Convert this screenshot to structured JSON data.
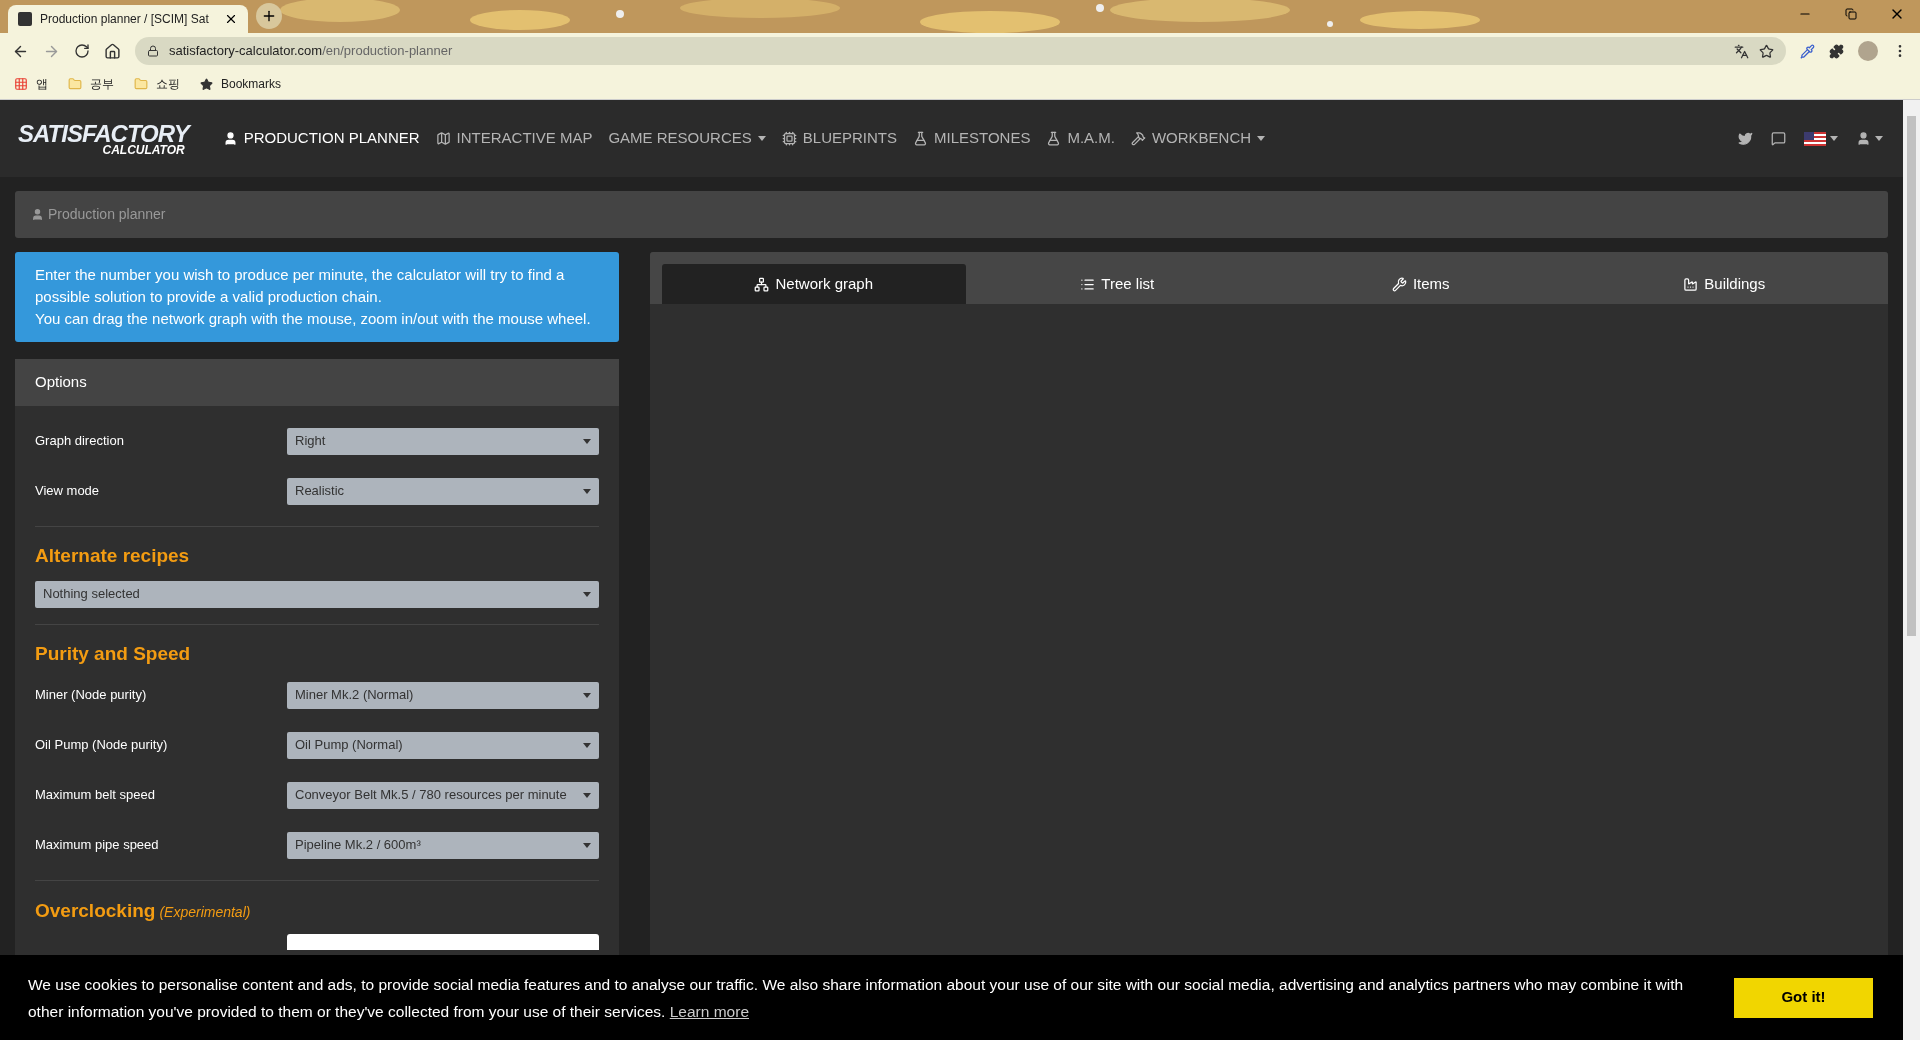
{
  "browser": {
    "tab_title": "Production planner / [SCIM] Sat",
    "url_domain": "satisfactory-calculator.com",
    "url_path": "/en/production-planner",
    "bookmarks": [
      {
        "label": "앱",
        "kind": "apps"
      },
      {
        "label": "공부",
        "kind": "folder"
      },
      {
        "label": "쇼핑",
        "kind": "folder"
      },
      {
        "label": "Bookmarks",
        "kind": "star"
      }
    ]
  },
  "logo": {
    "line1": "SATISFACTORY",
    "line2": "CALCULATOR"
  },
  "nav": [
    {
      "label": "PRODUCTION PLANNER",
      "kind": "user",
      "selected": true,
      "dropdown": false
    },
    {
      "label": "INTERACTIVE MAP",
      "kind": "map",
      "selected": false,
      "dropdown": false
    },
    {
      "label": "GAME RESOURCES",
      "kind": "none",
      "selected": false,
      "dropdown": true
    },
    {
      "label": "BLUEPRINTS",
      "kind": "chip",
      "selected": false,
      "dropdown": false
    },
    {
      "label": "MILESTONES",
      "kind": "flask",
      "selected": false,
      "dropdown": false
    },
    {
      "label": "M.A.M.",
      "kind": "flask",
      "selected": false,
      "dropdown": false
    },
    {
      "label": "WORKBENCH",
      "kind": "hammer",
      "selected": false,
      "dropdown": true
    }
  ],
  "breadcrumb": "Production planner",
  "info": [
    "Enter the number you wish to produce per minute, the calculator will try to find a possible solution to provide a valid production chain.",
    "You can drag the network graph with the mouse, zoom in/out with the mouse wheel."
  ],
  "options": {
    "title": "Options",
    "rows": [
      {
        "label": "Graph direction",
        "value": "Right"
      },
      {
        "label": "View mode",
        "value": "Realistic"
      }
    ],
    "alternate_recipes": {
      "heading": "Alternate recipes",
      "value": "Nothing selected"
    },
    "purity": {
      "heading": "Purity and Speed",
      "rows": [
        {
          "label": "Miner (Node purity)",
          "value": "Miner Mk.2 (Normal)"
        },
        {
          "label": "Oil Pump (Node purity)",
          "value": "Oil Pump (Normal)"
        },
        {
          "label": "Maximum belt speed",
          "value": "Conveyor Belt Mk.5 / 780 resources per minute"
        },
        {
          "label": "Maximum pipe speed",
          "value": "Pipeline Mk.2 / 600m³"
        }
      ]
    },
    "overclocking": {
      "heading": "Overclocking",
      "note": "(Experimental)"
    }
  },
  "tabs": [
    {
      "label": "Network graph",
      "kind": "network",
      "selected": true
    },
    {
      "label": "Tree list",
      "kind": "list",
      "selected": false
    },
    {
      "label": "Items",
      "kind": "tools",
      "selected": false
    },
    {
      "label": "Buildings",
      "kind": "factory",
      "selected": false
    }
  ],
  "cookie": {
    "text": "We use cookies to personalise content and ads, to provide social media features and to analyse our traffic. We also share information about your use of our site with our social media, advertising and analytics partners who may combine it with other information you've provided to them or they've collected from your use of their services.",
    "link": "Learn more",
    "button": "Got it!"
  }
}
